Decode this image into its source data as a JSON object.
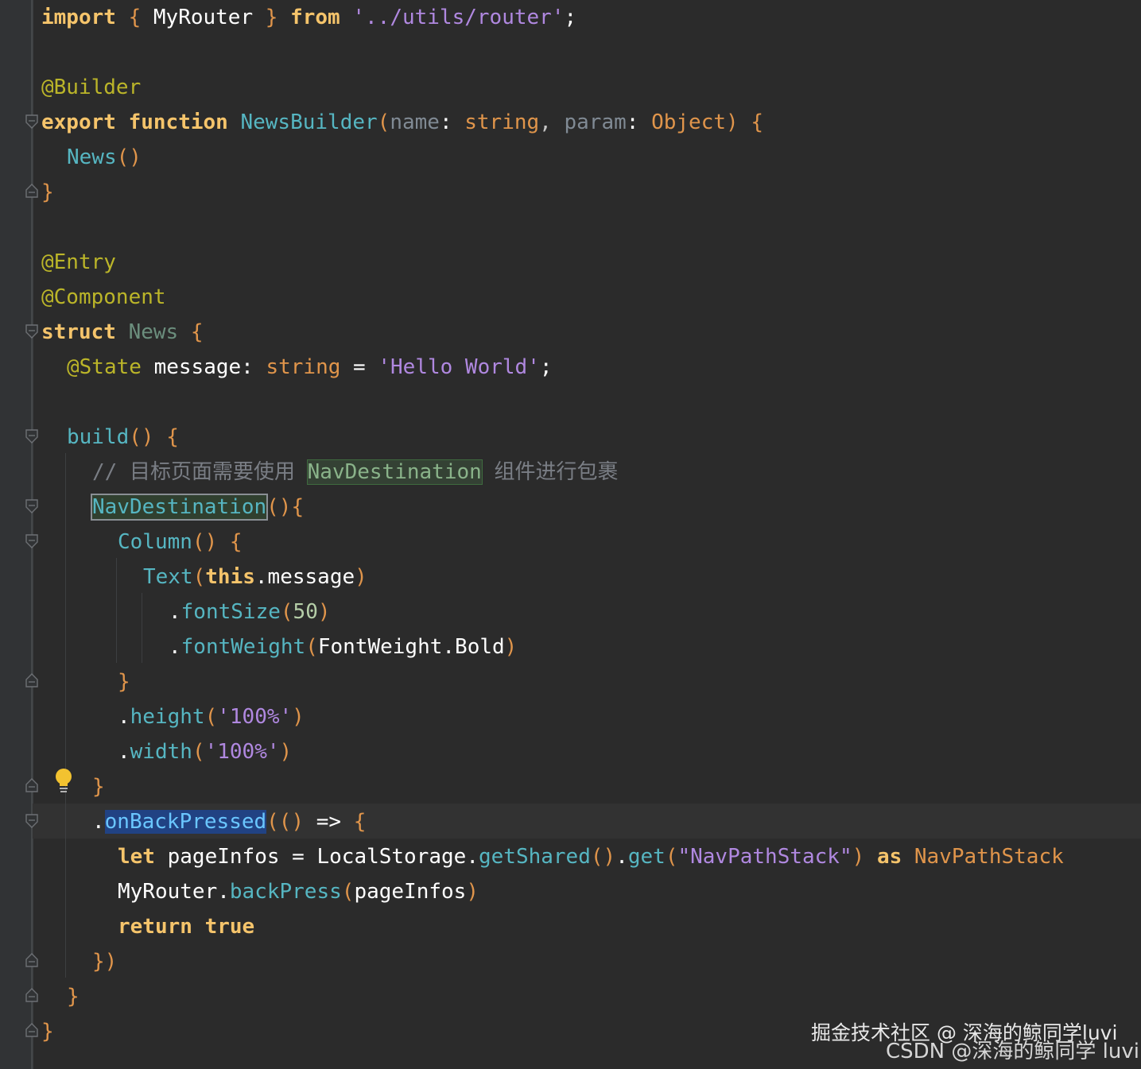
{
  "editor": {
    "lines": {
      "l1": {
        "import": "import",
        "lb": "{",
        "name": "MyRouter",
        "rb": "}",
        "from": "from",
        "path": "'../utils/router'",
        "semi": ";"
      },
      "l3": {
        "ann": "@Builder"
      },
      "l4": {
        "export": "export",
        "function": "function",
        "name": "NewsBuilder",
        "open": "(",
        "p1": "name",
        "c1": ":",
        "t1": "string",
        "comma": ",",
        "p2": "param",
        "c2": ":",
        "t2": "Object",
        "close": ")",
        "brace": "{"
      },
      "l5": {
        "call": "News",
        "parens": "()"
      },
      "l6": {
        "brace": "}"
      },
      "l8": {
        "ann": "@Entry"
      },
      "l9": {
        "ann": "@Component"
      },
      "l10": {
        "struct": "struct",
        "name": "News",
        "brace": "{"
      },
      "l11": {
        "ann": "@State",
        "field": "message",
        "colon": ":",
        "type": "string",
        "eq": "=",
        "value": "'Hello World'",
        "semi": ";"
      },
      "l13": {
        "name": "build",
        "parens": "()",
        "brace": "{"
      },
      "l14": {
        "slashes": "//",
        "text_before": "目标页面需要使用",
        "highlight": "NavDestination",
        "text_after": "组件进行包裹"
      },
      "l15": {
        "name": "NavDestination",
        "rest": "(){"
      },
      "l16": {
        "name": "Column",
        "parens": "()",
        "brace": "{"
      },
      "l17": {
        "name": "Text",
        "open": "(",
        "this": "this",
        "rest": ".message",
        "close": ")"
      },
      "l18": {
        "dot": ".",
        "name": "fontSize",
        "open": "(",
        "num": "50",
        "close": ")"
      },
      "l19": {
        "dot": ".",
        "name": "fontWeight",
        "open": "(",
        "arg": "FontWeight.Bold",
        "close": ")"
      },
      "l20": {
        "brace": "}"
      },
      "l21": {
        "dot": ".",
        "name": "height",
        "open": "(",
        "value": "'100%'",
        "close": ")"
      },
      "l22": {
        "dot": ".",
        "name": "width",
        "open": "(",
        "value": "'100%'",
        "close": ")"
      },
      "l23": {
        "brace": "}"
      },
      "l24": {
        "dot": ".",
        "name": "onBackPressed",
        "open": "((",
        "close": ")",
        "arrow": "=>",
        "brace": "{"
      },
      "l25": {
        "let": "let",
        "var": "pageInfos",
        "eq": "=",
        "obj": "LocalStorage",
        "dot1": ".",
        "m1": "getShared",
        "p1": "()",
        "dot2": ".",
        "m2": "get",
        "open": "(",
        "key": "\"NavPathStack\"",
        "close": ")",
        "as": "as",
        "type": "NavPathStack"
      },
      "l26": {
        "obj": "MyRouter",
        "dot": ".",
        "method": "backPress",
        "open": "(",
        "arg": "pageInfos",
        "close": ")"
      },
      "l27": {
        "ret": "return",
        "val": "true"
      },
      "l28": {
        "brace": "}",
        "paren": ")"
      },
      "l29": {
        "brace": "}"
      },
      "l30": {
        "brace": "}"
      }
    },
    "colors": {
      "background": "#2b2b2b",
      "keyword": "#f5c46b",
      "function": "#56b6c2",
      "type": "#e0954b",
      "string": "#b088e0",
      "annotation": "#bbb529"
    }
  },
  "watermarks": {
    "juejin": "掘金技术社区 @ 深海的鲸同学luvi",
    "csdn": "CSDN @深海的鲸同学 luvi"
  }
}
